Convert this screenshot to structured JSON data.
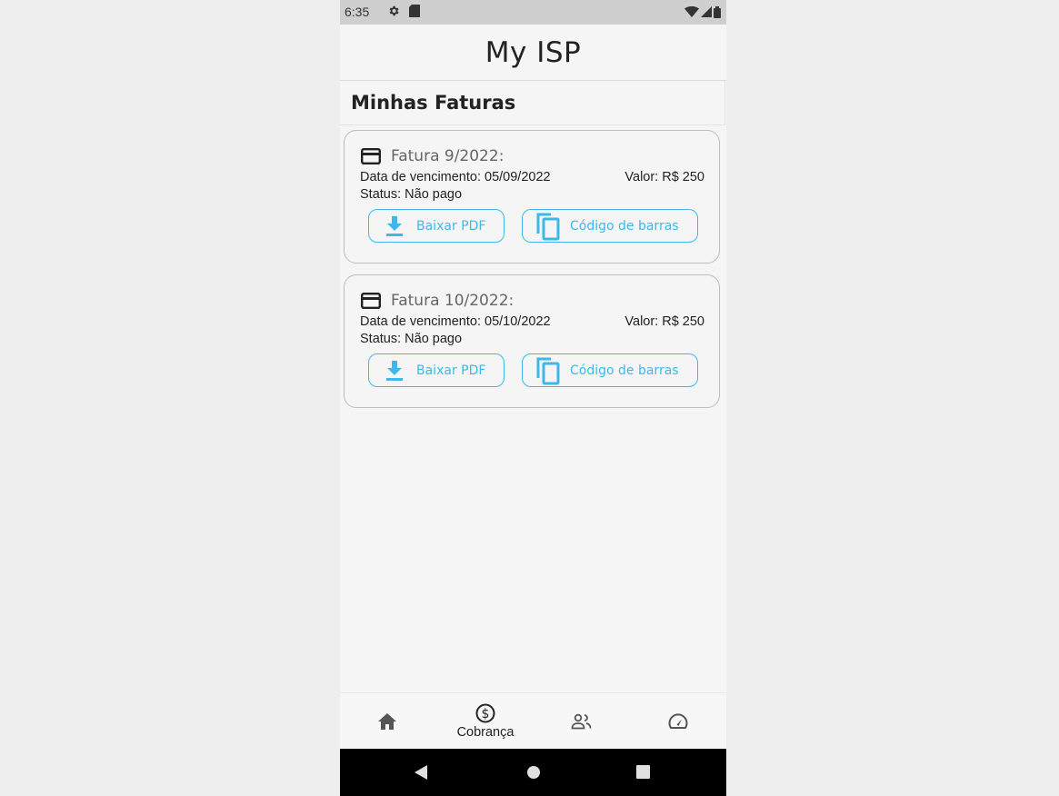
{
  "status_bar": {
    "time": "6:35"
  },
  "app": {
    "title": "My ISP"
  },
  "section": {
    "title": "Minhas Faturas"
  },
  "invoices": [
    {
      "title": "Fatura 9/2022:",
      "due": "Data de vencimento: 05/09/2022",
      "value": "Valor: R$ 250",
      "status": "Status: Não pago",
      "pdf_label": "Baixar PDF",
      "barcode_label": "Código de barras"
    },
    {
      "title": "Fatura 10/2022:",
      "due": "Data de vencimento: 05/10/2022",
      "value": "Valor: R$ 250",
      "status": "Status: Não pago",
      "pdf_label": "Baixar PDF",
      "barcode_label": "Código de barras"
    }
  ],
  "bottom_nav": {
    "items": [
      {
        "icon": "home-icon",
        "label": ""
      },
      {
        "icon": "dollar-circle-icon",
        "label": "Cobrança"
      },
      {
        "icon": "people-icon",
        "label": ""
      },
      {
        "icon": "speedometer-icon",
        "label": ""
      }
    ],
    "active_index": 1
  },
  "colors": {
    "accent": "#3db8ea",
    "background": "#f5f5f5",
    "status_bar": "#cfcfcf"
  }
}
